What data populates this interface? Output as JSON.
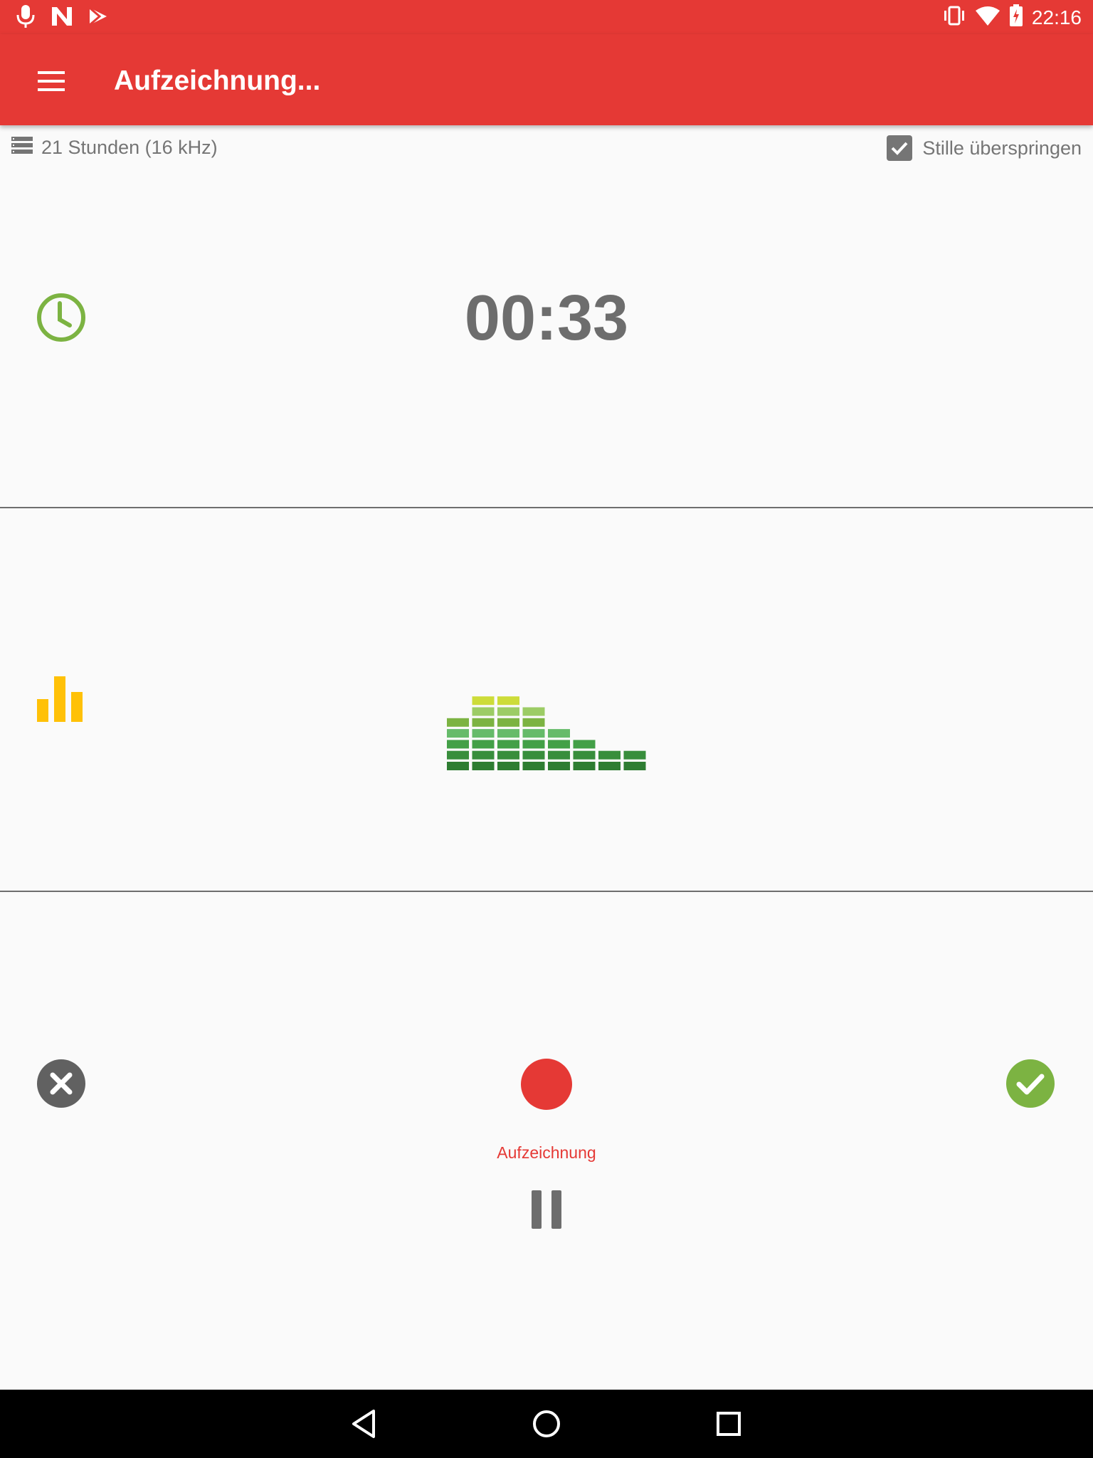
{
  "status_bar": {
    "time": "22:16",
    "left_icons": [
      "mic-icon",
      "n-icon",
      "play-store-icon"
    ],
    "right_icons": [
      "vibrate-icon",
      "wifi-icon",
      "battery-charging-icon"
    ]
  },
  "app_bar": {
    "title": "Aufzeichnung...",
    "color": "#e53935"
  },
  "info_row": {
    "storage_text": "21 Stunden (16 kHz)",
    "skip_silence_label": "Stille überspringen",
    "skip_silence_checked": true
  },
  "timer": {
    "value": "00:33"
  },
  "level_meter": {
    "column_levels": [
      5,
      7,
      7,
      6,
      4,
      3,
      2,
      2
    ],
    "max_level": 7,
    "colors": [
      "#2e7d32",
      "#388e3c",
      "#43a047",
      "#66bb6a",
      "#7cb342",
      "#9ccc65",
      "#cddc39"
    ]
  },
  "controls": {
    "record_label": "Aufzeichnung",
    "record_color": "#e53935",
    "cancel_color": "#616161",
    "confirm_color": "#7cb342"
  },
  "colors": {
    "clock_icon": "#7cb342",
    "level_icon": "#ffc107",
    "text_gray": "#757575"
  }
}
